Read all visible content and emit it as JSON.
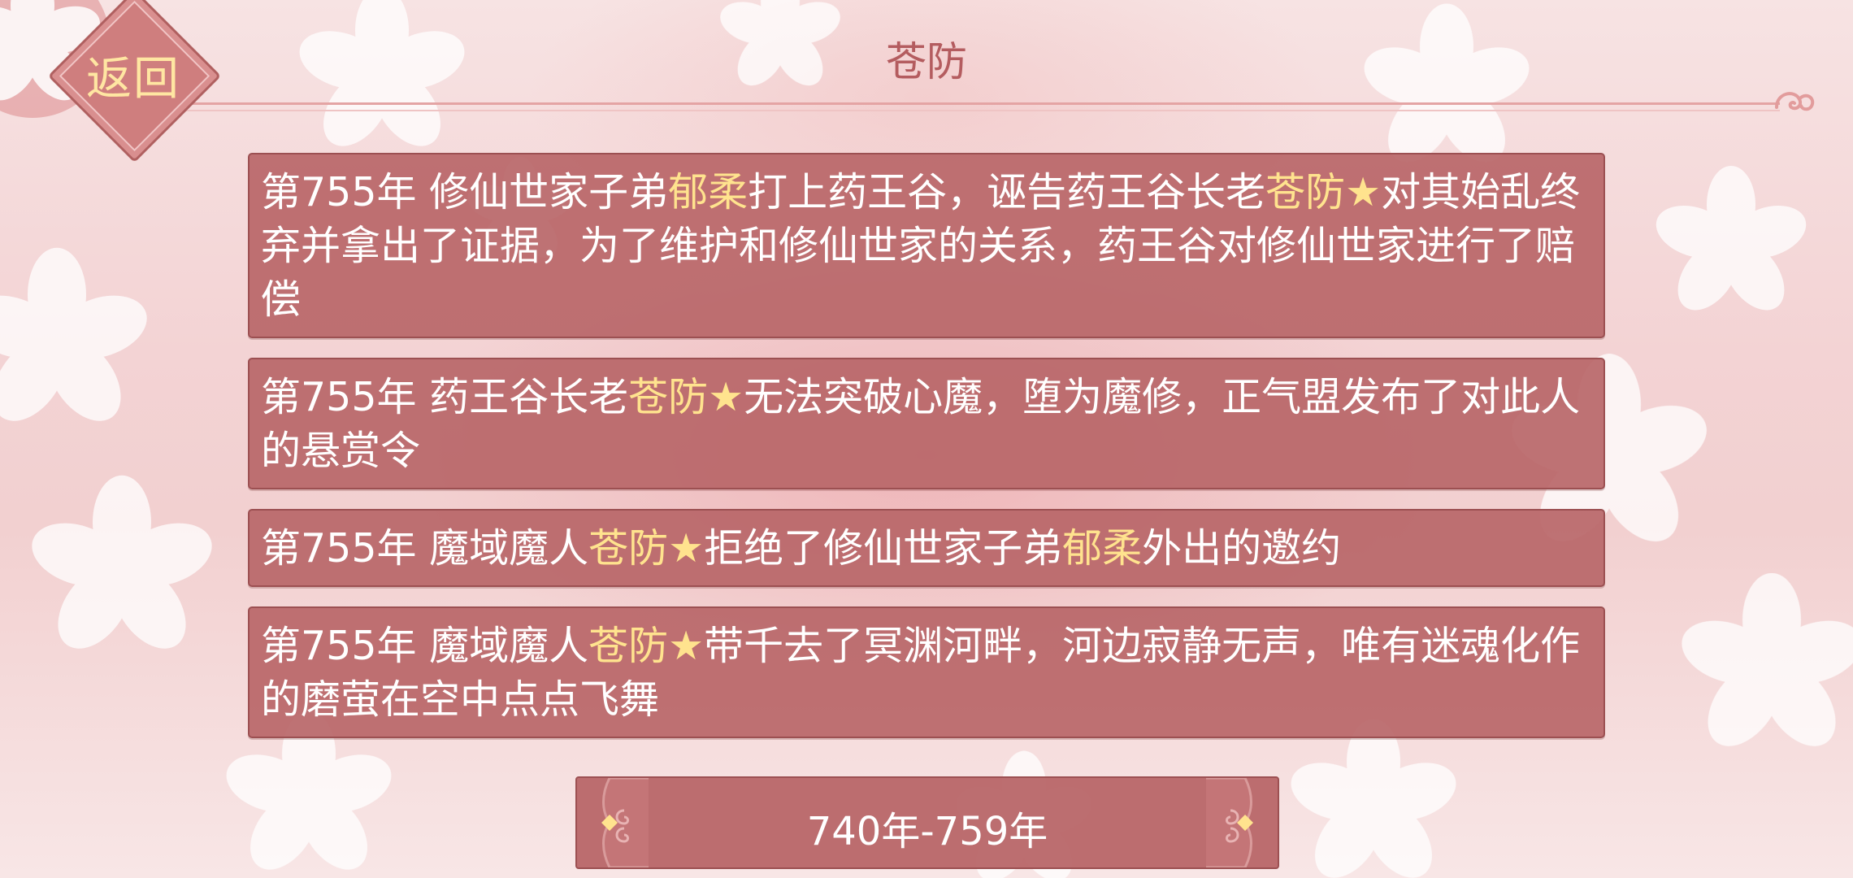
{
  "header": {
    "back_label": "返回",
    "title": "苍防"
  },
  "events": [
    {
      "parts": [
        {
          "t": "第755年 修仙世家子弟"
        },
        {
          "t": "郁柔",
          "hl": true
        },
        {
          "t": "打上药王谷，诬告药王谷长老"
        },
        {
          "t": "苍防",
          "hl": true
        },
        {
          "t": "★",
          "star": true
        },
        {
          "t": "对其始乱终弃并拿出了证据，为了维护和修仙世家的关系，药王谷对修仙世家进行了赔偿"
        }
      ]
    },
    {
      "parts": [
        {
          "t": "第755年 药王谷长老"
        },
        {
          "t": "苍防",
          "hl": true
        },
        {
          "t": "★",
          "star": true
        },
        {
          "t": "无法突破心魔，堕为魔修，正气盟发布了对此人的悬赏令"
        }
      ]
    },
    {
      "parts": [
        {
          "t": "第755年 魔域魔人"
        },
        {
          "t": "苍防",
          "hl": true
        },
        {
          "t": "★",
          "star": true
        },
        {
          "t": "拒绝了修仙世家子弟"
        },
        {
          "t": "郁柔",
          "hl": true
        },
        {
          "t": "外出的邀约"
        }
      ]
    },
    {
      "parts": [
        {
          "t": "第755年 魔域魔人"
        },
        {
          "t": "苍防",
          "hl": true
        },
        {
          "t": "★",
          "star": true
        },
        {
          "t": "带千去了冥渊河畔，河边寂静无声，唯有迷魂化作的磨萤在空中点点飞舞"
        }
      ]
    }
  ],
  "period": {
    "label": "740年-759年"
  },
  "colors": {
    "card_bg": "#b86668",
    "highlight": "#ffe38e",
    "title": "#b45c5f",
    "back_text": "#ffe6a2"
  }
}
